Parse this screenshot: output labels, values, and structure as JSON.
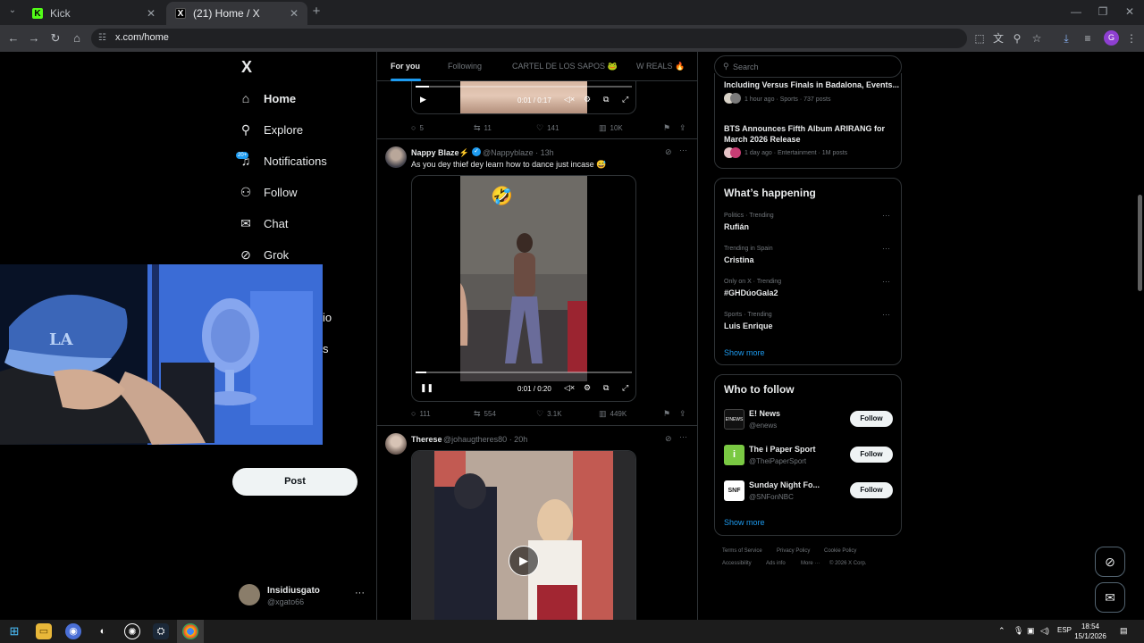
{
  "browser": {
    "tabs": [
      {
        "title": "Kick",
        "close": "✕"
      },
      {
        "title": "(21) Home / X",
        "close": "✕"
      }
    ],
    "new_tab": "+",
    "url": "x.com/home",
    "profile_initial": "G",
    "window_controls": {
      "minimize": "—",
      "restore": "❐",
      "close": "✕"
    }
  },
  "sidebar": {
    "logo": "X",
    "items": [
      {
        "label": "Home",
        "icon": "home-icon"
      },
      {
        "label": "Explore",
        "icon": "search-icon"
      },
      {
        "label": "Notifications",
        "icon": "bell-icon",
        "badge": "20+"
      },
      {
        "label": "Follow",
        "icon": "person-plus-icon"
      },
      {
        "label": "Chat",
        "icon": "mail-icon"
      },
      {
        "label": "Grok",
        "icon": "grok-icon"
      }
    ],
    "partial_labels": [
      "io",
      "s"
    ],
    "post_label": "Post",
    "account": {
      "name": "Insidiusgato",
      "handle": "@xgato66",
      "more": "···"
    }
  },
  "feed": {
    "tabs": [
      "For you",
      "Following",
      "CARTEL DE LOS SAPOS 🐸",
      "W REALS 🔥"
    ],
    "tweets": [
      {
        "video_time": "0:01 / 0:17",
        "progress": 0.06,
        "replies": "5",
        "reposts": "11",
        "likes": "141",
        "views": "10K"
      },
      {
        "name": "Nappy Blaze⚡",
        "handle": "@Nappyblaze · 13h",
        "text": "As you dey thief dey learn how to dance just incase 😅",
        "video_time": "0:01 / 0:20",
        "progress": 0.05,
        "replies": "111",
        "reposts": "554",
        "likes": "3.1K",
        "views": "449K",
        "overlay_emoji": "🤣"
      },
      {
        "name": "Therese",
        "handle": "@johaugtheres80 · 20h"
      }
    ]
  },
  "right": {
    "search_placeholder": "Search",
    "news": [
      {
        "title": "Including Versus Finals in Badalona, Events...",
        "meta": "1 hour ago · Sports · 737 posts"
      },
      {
        "title": "BTS Announces Fifth Album ARIRANG for March 2026 Release",
        "meta": "1 day ago · Entertainment · 1M posts"
      }
    ],
    "happening": {
      "title": "What’s happening",
      "trends": [
        {
          "category": "Politics · Trending",
          "name": "Rufián"
        },
        {
          "category": "Trending in Spain",
          "name": "Cristina"
        },
        {
          "category": "Only on X · Trending",
          "name": "#GHDúoGala2"
        },
        {
          "category": "Sports · Trending",
          "name": "Luis Enrique"
        }
      ],
      "show_more": "Show more"
    },
    "who_to_follow": {
      "title": "Who to follow",
      "accounts": [
        {
          "name": "E! News",
          "handle": "@enews",
          "button": "Follow",
          "avatar_text": "E!NEWS"
        },
        {
          "name": "The i Paper Sport",
          "handle": "@TheiPaperSport",
          "button": "Follow",
          "avatar_text": "i"
        },
        {
          "name": "Sunday Night Fo...",
          "handle": "@SNFonNBC",
          "button": "Follow",
          "avatar_text": "SNF"
        }
      ],
      "show_more": "Show more"
    },
    "footer": [
      "Terms of Service",
      "Privacy Policy",
      "Cookie Policy",
      "Accessibility",
      "Ads info",
      "More ···",
      "© 2026 X Corp."
    ]
  },
  "taskbar": {
    "language": "ESP",
    "time": "18:54",
    "date": "15/1/2026"
  },
  "colors": {
    "accent": "#1d9bf0",
    "background": "#000000",
    "border": "#2f3336",
    "muted": "#71767b"
  }
}
